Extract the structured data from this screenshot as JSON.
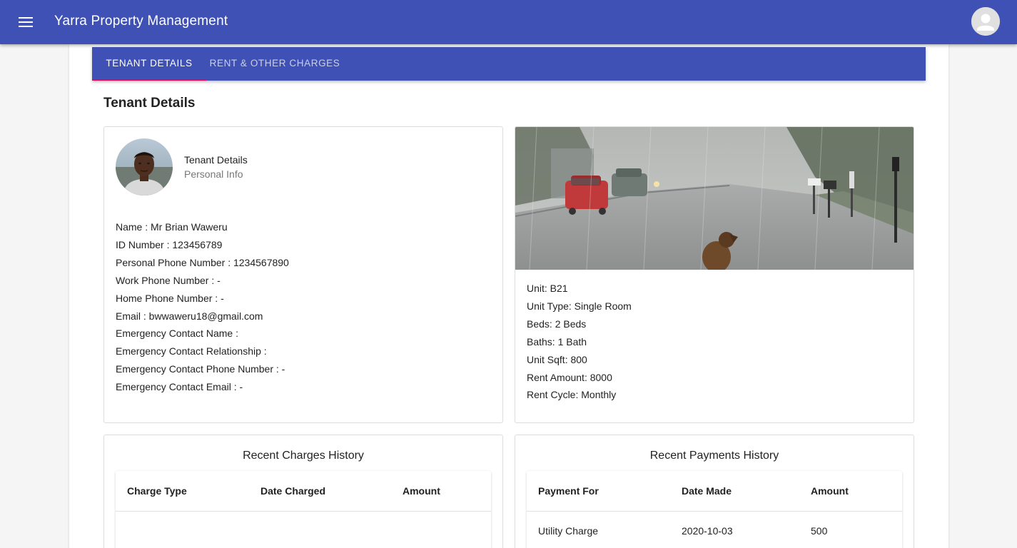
{
  "app": {
    "title": "Yarra Property Management"
  },
  "tabs": [
    {
      "label": "TENANT DETAILS",
      "active": true
    },
    {
      "label": "RENT & OTHER CHARGES",
      "active": false
    }
  ],
  "section_title": "Tenant Details",
  "tenant_card": {
    "title": "Tenant Details",
    "subtitle": "Personal Info",
    "fields": [
      "Name : Mr Brian Waweru",
      "ID Number : 123456789",
      "Personal Phone Number : 1234567890",
      "Work Phone Number : -",
      "Home Phone Number : -",
      "Email : bwwaweru18@gmail.com",
      "Emergency Contact Name :",
      "Emergency Contact Relationship :",
      "Emergency Contact Phone Number : -",
      "Emergency Contact Email : -"
    ]
  },
  "unit_card": {
    "fields": [
      "Unit: B21",
      "Unit Type: Single Room",
      "Beds: 2 Beds",
      "Baths: 1 Bath",
      "Unit Sqft: 800",
      "Rent Amount: 8000",
      "Rent Cycle: Monthly"
    ]
  },
  "charges_history": {
    "title": "Recent Charges History",
    "columns": [
      "Charge Type",
      "Date Charged",
      "Amount"
    ],
    "rows": []
  },
  "payments_history": {
    "title": "Recent Payments History",
    "columns": [
      "Payment For",
      "Date Made",
      "Amount"
    ],
    "rows": [
      [
        "Utility Charge",
        "2020-10-03",
        "500"
      ]
    ]
  },
  "colors": {
    "app_bar": "#3f51b5",
    "tab_indicator": "#f50057",
    "page_bg": "#f5f5f5"
  },
  "icons": {
    "menu": "menu-icon",
    "account": "account-circle-icon"
  }
}
